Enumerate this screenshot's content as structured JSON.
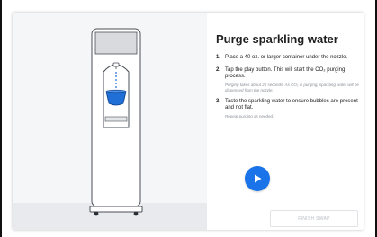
{
  "page": {
    "title": "Purge sparkling water"
  },
  "steps": [
    {
      "number": "1.",
      "text": "Place a 40 oz. or larger container under the nozzle.",
      "note": ""
    },
    {
      "number": "2.",
      "text": "Tap the play button. This will start the CO₂ purging process.",
      "note": "Purging takes about 25 seconds. As CO₂ is purging, sparkling water will be dispensed from the nozzle."
    },
    {
      "number": "3.",
      "text": "Taste the sparkling water to ensure bubbles are present and not flat.",
      "note": "Repeat purging as needed."
    }
  ],
  "actions": {
    "play_icon": "play-icon",
    "finish_label": "FINISH SWAP"
  },
  "colors": {
    "accent": "#1a73e8",
    "container": "#1f6fd6",
    "panel": "#f5f6f8"
  }
}
